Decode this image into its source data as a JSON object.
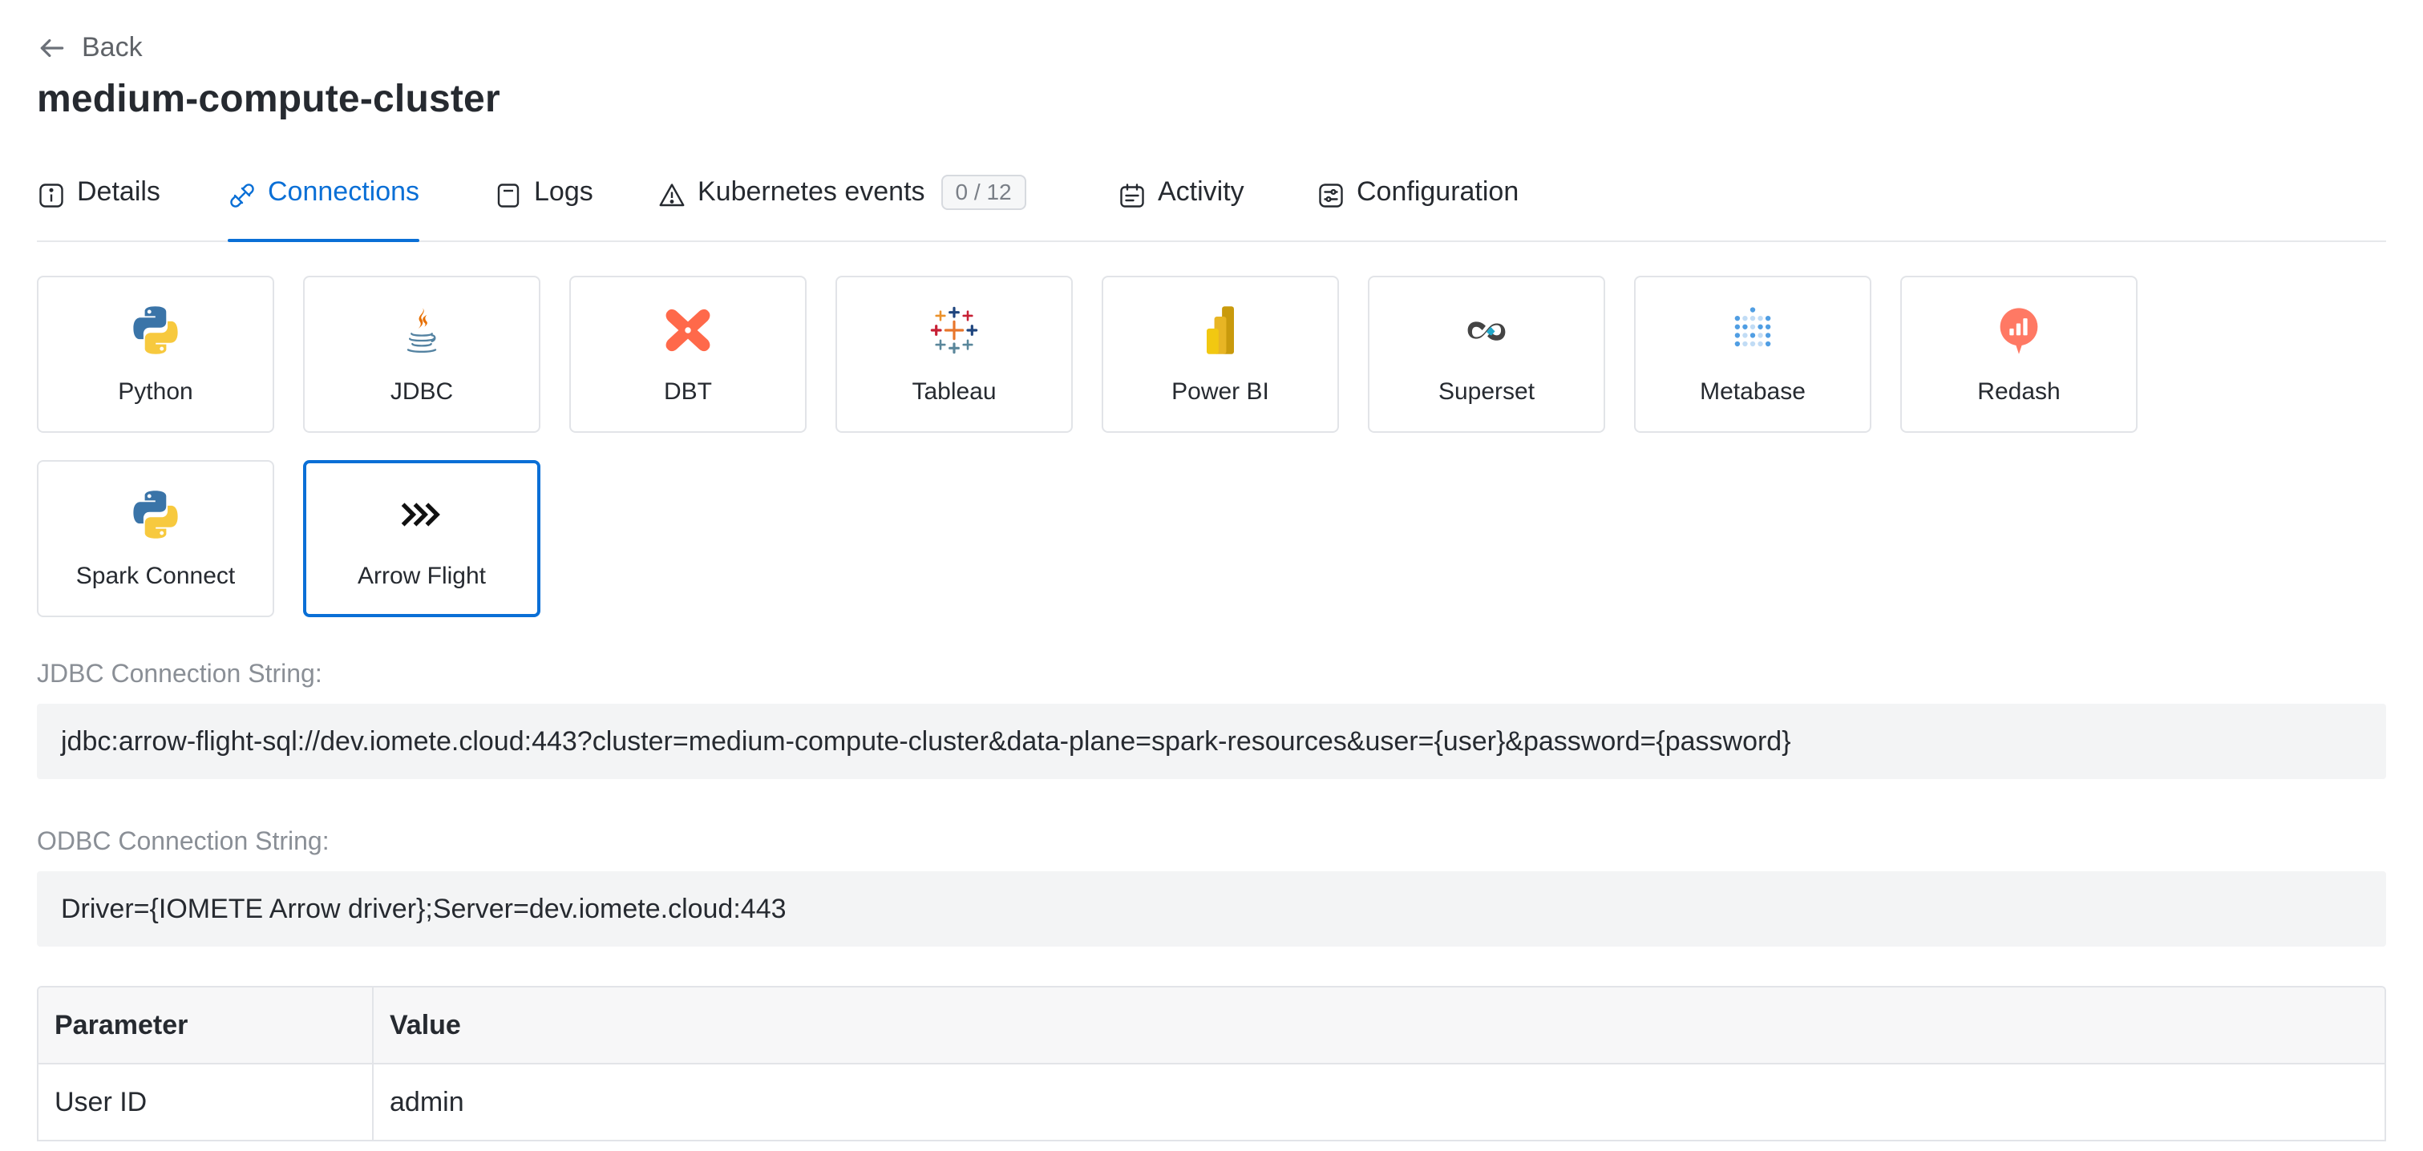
{
  "header": {
    "back_label": "Back",
    "title": "medium-compute-cluster"
  },
  "tabs": [
    {
      "label": "Details",
      "icon": "info-icon"
    },
    {
      "label": "Connections",
      "icon": "link-icon",
      "active": true
    },
    {
      "label": "Logs",
      "icon": "logs-icon"
    },
    {
      "label": "Kubernetes events",
      "icon": "warning-icon",
      "badge": "0 / 12"
    },
    {
      "label": "Activity",
      "icon": "activity-icon"
    },
    {
      "label": "Configuration",
      "icon": "configuration-icon"
    }
  ],
  "connections": [
    {
      "label": "Python",
      "icon": "python-icon"
    },
    {
      "label": "JDBC",
      "icon": "java-icon"
    },
    {
      "label": "DBT",
      "icon": "dbt-icon"
    },
    {
      "label": "Tableau",
      "icon": "tableau-icon"
    },
    {
      "label": "Power BI",
      "icon": "powerbi-icon"
    },
    {
      "label": "Superset",
      "icon": "superset-icon"
    },
    {
      "label": "Metabase",
      "icon": "metabase-icon"
    },
    {
      "label": "Redash",
      "icon": "redash-icon"
    },
    {
      "label": "Spark Connect",
      "icon": "python-icon"
    },
    {
      "label": "Arrow Flight",
      "icon": "arrow-flight-icon",
      "selected": true
    }
  ],
  "jdbc": {
    "label": "JDBC Connection String:",
    "value": "jdbc:arrow-flight-sql://dev.iomete.cloud:443?cluster=medium-compute-cluster&data-plane=spark-resources&user={user}&password={password}"
  },
  "odbc": {
    "label": "ODBC Connection String:",
    "value": "Driver={IOMETE Arrow driver};Server=dev.iomete.cloud:443"
  },
  "params_table": {
    "headers": [
      "Parameter",
      "Value"
    ],
    "rows": [
      [
        "User ID",
        "admin"
      ]
    ]
  },
  "colors": {
    "accent": "#0a6fd6",
    "text": "#262a30",
    "muted": "#8a8f96",
    "border": "#e2e4e8",
    "code_bg": "#f3f4f5"
  }
}
